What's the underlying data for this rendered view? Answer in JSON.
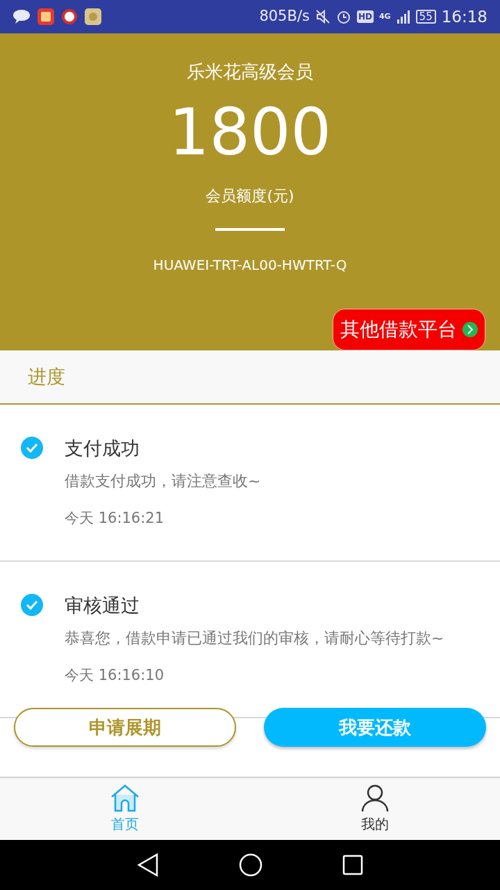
{
  "status_bar": {
    "speed": "805B/s",
    "hd": "HD",
    "network": "4G",
    "battery": "55",
    "time": "16:18"
  },
  "header": {
    "title": "乐米花高级会员",
    "amount": "1800",
    "amount_label": "会员额度(元)",
    "device": "HUAWEI-TRT-AL00-HWTRT-Q",
    "platform_button": "其他借款平台"
  },
  "progress": {
    "heading": "进度",
    "steps": [
      {
        "title": "支付成功",
        "description": "借款支付成功，请注意查收~",
        "time": "今天 16:16:21",
        "checked": true
      },
      {
        "title": "审核通过",
        "description": "恭喜您，借款申请已通过我们的审核，请耐心等待打款~",
        "time": "今天 16:16:10",
        "checked": true
      }
    ]
  },
  "actions": [
    {
      "label": "申请展期",
      "kind": "outline"
    },
    {
      "label": "我要还款",
      "kind": "filled"
    }
  ],
  "bottom_nav": [
    {
      "label": "首页",
      "kind": "home",
      "selected": true
    },
    {
      "label": "我的",
      "kind": "profile",
      "selected": false
    }
  ]
}
